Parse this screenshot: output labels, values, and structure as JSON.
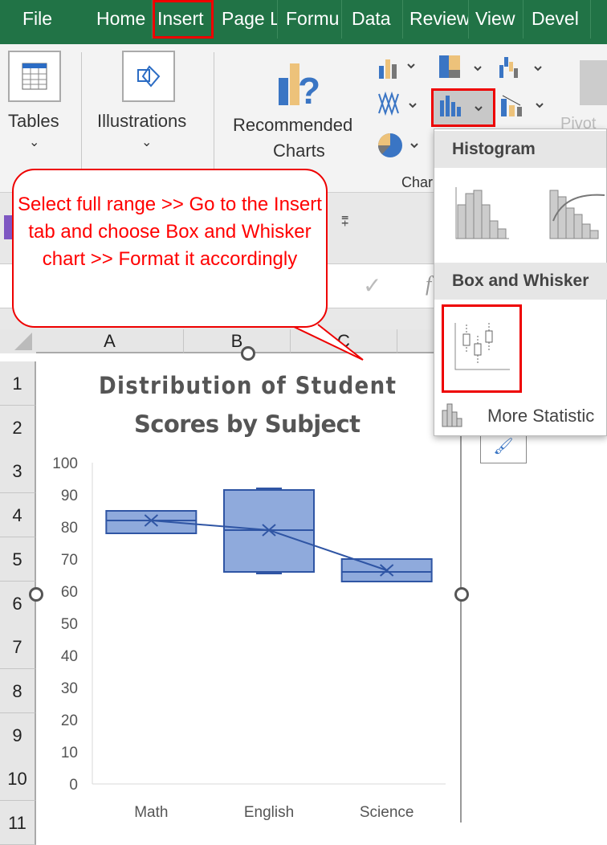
{
  "tabs": [
    "File",
    "Home",
    "Insert",
    "Page L",
    "Formu",
    "Data",
    "Review",
    "View",
    "Devel"
  ],
  "ribbon": {
    "tables": "Tables",
    "illustrations": "Illustrations",
    "recommended_line1": "Recommended",
    "recommended_line2": "Charts",
    "charts_group": "Char",
    "pivot": "Pivot"
  },
  "callout": "Select full range >> Go to the Insert tab and choose Box and Whisker chart >> Format it accordingly",
  "columns": [
    "A",
    "B",
    "C"
  ],
  "rows": [
    "1",
    "2",
    "3",
    "4",
    "5",
    "6",
    "7",
    "8",
    "9",
    "10",
    "11"
  ],
  "dropdown": {
    "histogram": "Histogram",
    "box_whisker": "Box and Whisker",
    "more": "More Statistic"
  },
  "colors": {
    "excel_green": "#217346",
    "box_fill": "#8faadc",
    "box_line": "#2f55a4",
    "highlight": "#e00000"
  },
  "chart_data": {
    "type": "box",
    "title": "Distribution of Student Scores by Subject",
    "title_line1": "Distribution of Student",
    "title_line2": "Scores by Subject",
    "categories": [
      "Math",
      "English",
      "Science"
    ],
    "min": [
      78,
      65.5,
      63
    ],
    "q1": [
      78,
      66,
      63
    ],
    "median": [
      82,
      79,
      66
    ],
    "q3": [
      85,
      91.5,
      70
    ],
    "max": [
      85,
      92,
      70
    ],
    "mean": [
      82,
      79,
      66.5
    ],
    "ylim": [
      0,
      100
    ],
    "yticks": [
      "0",
      "10",
      "20",
      "30",
      "40",
      "50",
      "60",
      "70",
      "80",
      "90",
      "100"
    ],
    "mean_line": true
  }
}
